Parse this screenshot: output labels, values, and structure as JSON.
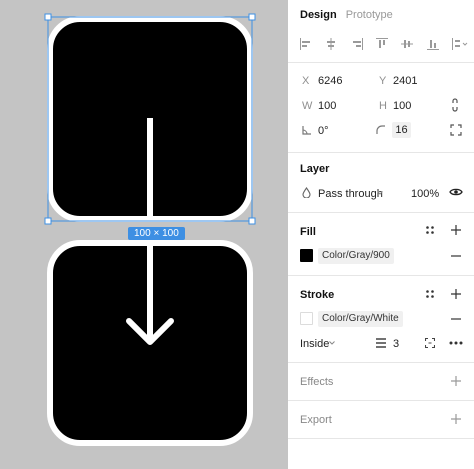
{
  "canvas": {
    "size_badge": "100 × 100"
  },
  "panel": {
    "tabs": {
      "design": "Design",
      "prototype": "Prototype"
    },
    "position": {
      "x_label": "X",
      "x_value": "6246",
      "y_label": "Y",
      "y_value": "2401"
    },
    "dimensions": {
      "w_label": "W",
      "w_value": "100",
      "h_label": "H",
      "h_value": "100"
    },
    "rotation": {
      "value": "0°"
    },
    "corner_radius": {
      "value": "16"
    },
    "layer": {
      "title": "Layer",
      "blend_mode": "Pass through",
      "opacity": "100%"
    },
    "fill": {
      "title": "Fill",
      "style_name": "Color/Gray/900",
      "swatch_color": "#000000"
    },
    "stroke": {
      "title": "Stroke",
      "style_name": "Color/Gray/White",
      "swatch_color": "#ffffff",
      "position": "Inside",
      "weight": "3"
    },
    "effects": {
      "title": "Effects"
    },
    "export": {
      "title": "Export"
    }
  }
}
